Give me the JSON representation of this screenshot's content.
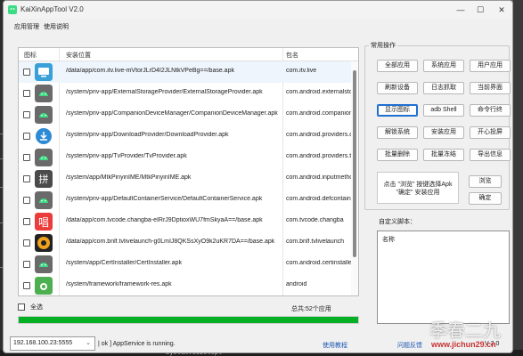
{
  "window": {
    "title": "KaiXinAppTool V2.0",
    "controls": {
      "minimize": "—",
      "maximize": "☐",
      "close": "✕"
    }
  },
  "menu": {
    "items": [
      "应用管理",
      "使用说明"
    ]
  },
  "table": {
    "headers": {
      "icon": "图标",
      "path": "安装位置",
      "package": "包名"
    },
    "rows": [
      {
        "icon": "tv-live-icon",
        "color": "#3aa0d8",
        "path": "/data/app/com.itv.live-mVtorJLrD4I2JLNtkVPeBg==/base.apk",
        "package": "com.itv.live"
      },
      {
        "icon": "android-icon",
        "color": "#3ddc84",
        "path": "/system/priv-app/ExternalStorageProvider/ExternalStorageProvider.apk",
        "package": "com.android.externalstorage"
      },
      {
        "icon": "android-icon",
        "color": "#3ddc84",
        "path": "/system/priv-app/CompanionDeviceManager/CompanionDeviceManager.apk",
        "package": "com.android.companiondevicemanager"
      },
      {
        "icon": "download-icon",
        "color": "#2d8bd5",
        "path": "/system/priv-app/DownloadProvider/DownloadProvider.apk",
        "package": "com.android.providers.downloads"
      },
      {
        "icon": "android-icon",
        "color": "#3ddc84",
        "path": "/system/priv-app/TvProvider/TvProvider.apk",
        "package": "com.android.providers.tv"
      },
      {
        "icon": "pinyin-ime-icon",
        "color": "#4b4b4b",
        "path": "/system/app/MtkPinyinIME/MtkPinyinIME.apk",
        "package": "com.android.inputmethod.pinyin"
      },
      {
        "icon": "android-icon",
        "color": "#3ddc84",
        "path": "/system/priv-app/DefaultContainerService/DefaultContainerService.apk",
        "package": "com.android.defcontainer"
      },
      {
        "icon": "changba-icon",
        "color": "#ec3b3b",
        "path": "/data/app/com.tvcode.changba-eIRrJ9DptioxWU7fmSkyaA==/base.apk",
        "package": "com.tvcode.changba"
      },
      {
        "icon": "tvlive-launch-icon",
        "color": "#f0a21c",
        "path": "/data/app/com.bnlf.tvlivelaunch-g0LmIJ8QKSsXyO9k2uKR7DA==/base.apk",
        "package": "com.bnlf.tvlivelaunch"
      },
      {
        "icon": "android-icon",
        "color": "#3ddc84",
        "path": "/system/app/CertInstaller/CertInstaller.apk",
        "package": "com.android.certinstaller"
      },
      {
        "icon": "camera-icon",
        "color": "#4caf50",
        "path": "/system/framework/framework-res.apk",
        "package": "android"
      }
    ]
  },
  "select_all_label": "全选",
  "total_label": "总共:52个应用",
  "progress": {
    "percent": 100,
    "color": "#06b025"
  },
  "status": {
    "ip_value": "192.168.100.23:5555",
    "message": "| ok ] AppService is running.",
    "link_tutorial": "使用教程",
    "link_feedback": "问题反馈",
    "version": "V 2.0"
  },
  "actions": {
    "group_title": "常用操作",
    "buttons": [
      "全部应用",
      "系统应用",
      "用户应用",
      "刷新设备",
      "日志抓取",
      "当前界面",
      "显示图标",
      "adb Shell",
      "命令行终",
      "解锁系统",
      "安装应用",
      "开心投屏",
      "批量删除",
      "批量冻结",
      "导出信息"
    ],
    "hint_line1": "点击 \"浏览\" 按键选择Apk",
    "hint_line2": "\"确定\" 安装应用",
    "browse_label": "浏览",
    "confirm_label": "确定"
  },
  "script": {
    "label": "自定义脚本：",
    "content": "名称"
  },
  "watermark": {
    "big": "季春二九",
    "small": "www.jichun29.cn"
  },
  "background_snippet": "System.Cobelopt"
}
